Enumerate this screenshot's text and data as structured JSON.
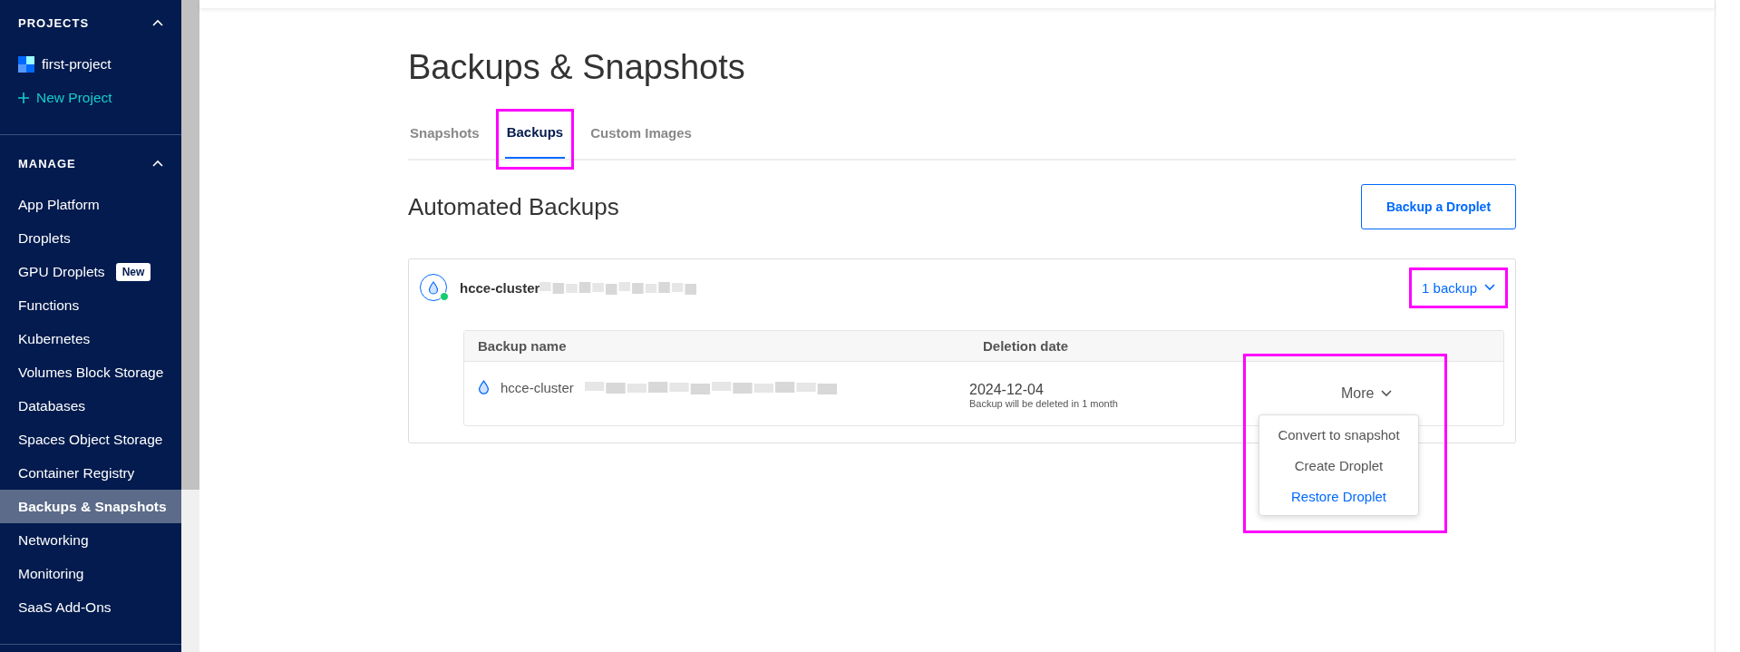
{
  "sidebar": {
    "sections": [
      {
        "title": "PROJECTS",
        "expanded": true,
        "items": [
          {
            "label": "first-project",
            "kind": "project",
            "selected": false
          },
          {
            "label": "New Project",
            "kind": "add",
            "selected": false
          }
        ]
      },
      {
        "title": "MANAGE",
        "expanded": true,
        "items": [
          {
            "label": "App Platform",
            "kind": "link",
            "selected": false
          },
          {
            "label": "Droplets",
            "kind": "link",
            "selected": false
          },
          {
            "label": "GPU Droplets",
            "kind": "link",
            "badge": "New",
            "selected": false
          },
          {
            "label": "Functions",
            "kind": "link",
            "selected": false
          },
          {
            "label": "Kubernetes",
            "kind": "link",
            "selected": false
          },
          {
            "label": "Volumes Block Storage",
            "kind": "link",
            "selected": false
          },
          {
            "label": "Databases",
            "kind": "link",
            "selected": false
          },
          {
            "label": "Spaces Object Storage",
            "kind": "link",
            "selected": false
          },
          {
            "label": "Container Registry",
            "kind": "link",
            "selected": false
          },
          {
            "label": "Backups & Snapshots",
            "kind": "link",
            "selected": true
          },
          {
            "label": "Networking",
            "kind": "link",
            "selected": false
          },
          {
            "label": "Monitoring",
            "kind": "link",
            "selected": false
          },
          {
            "label": "SaaS Add-Ons",
            "kind": "link",
            "selected": false
          }
        ]
      }
    ]
  },
  "page": {
    "title": "Backups & Snapshots",
    "tabs": [
      {
        "label": "Snapshots",
        "selected": false,
        "highlighted": false
      },
      {
        "label": "Backups",
        "selected": true,
        "highlighted": true
      },
      {
        "label": "Custom Images",
        "selected": false,
        "highlighted": false
      }
    ],
    "section_title": "Automated Backups",
    "action_button": "Backup a Droplet",
    "droplets": [
      {
        "name": "hcce-cluster",
        "online": true,
        "toggle": "1 backup",
        "expanded": true,
        "toggle_highlighted": true,
        "table": {
          "columns": [
            "Backup name",
            "Deletion date"
          ],
          "rows": [
            {
              "name": "hcce-cluster",
              "date": "2024-12-04",
              "note": "Backup will be deleted in 1 month",
              "action": "More",
              "menu_open": true,
              "menu_highlighted": true,
              "menu": [
                {
                  "label": "Convert to snapshot",
                  "kind": "normal"
                },
                {
                  "label": "Create Droplet",
                  "kind": "normal"
                },
                {
                  "label": "Restore Droplet",
                  "kind": "primary"
                }
              ]
            }
          ]
        }
      }
    ]
  }
}
